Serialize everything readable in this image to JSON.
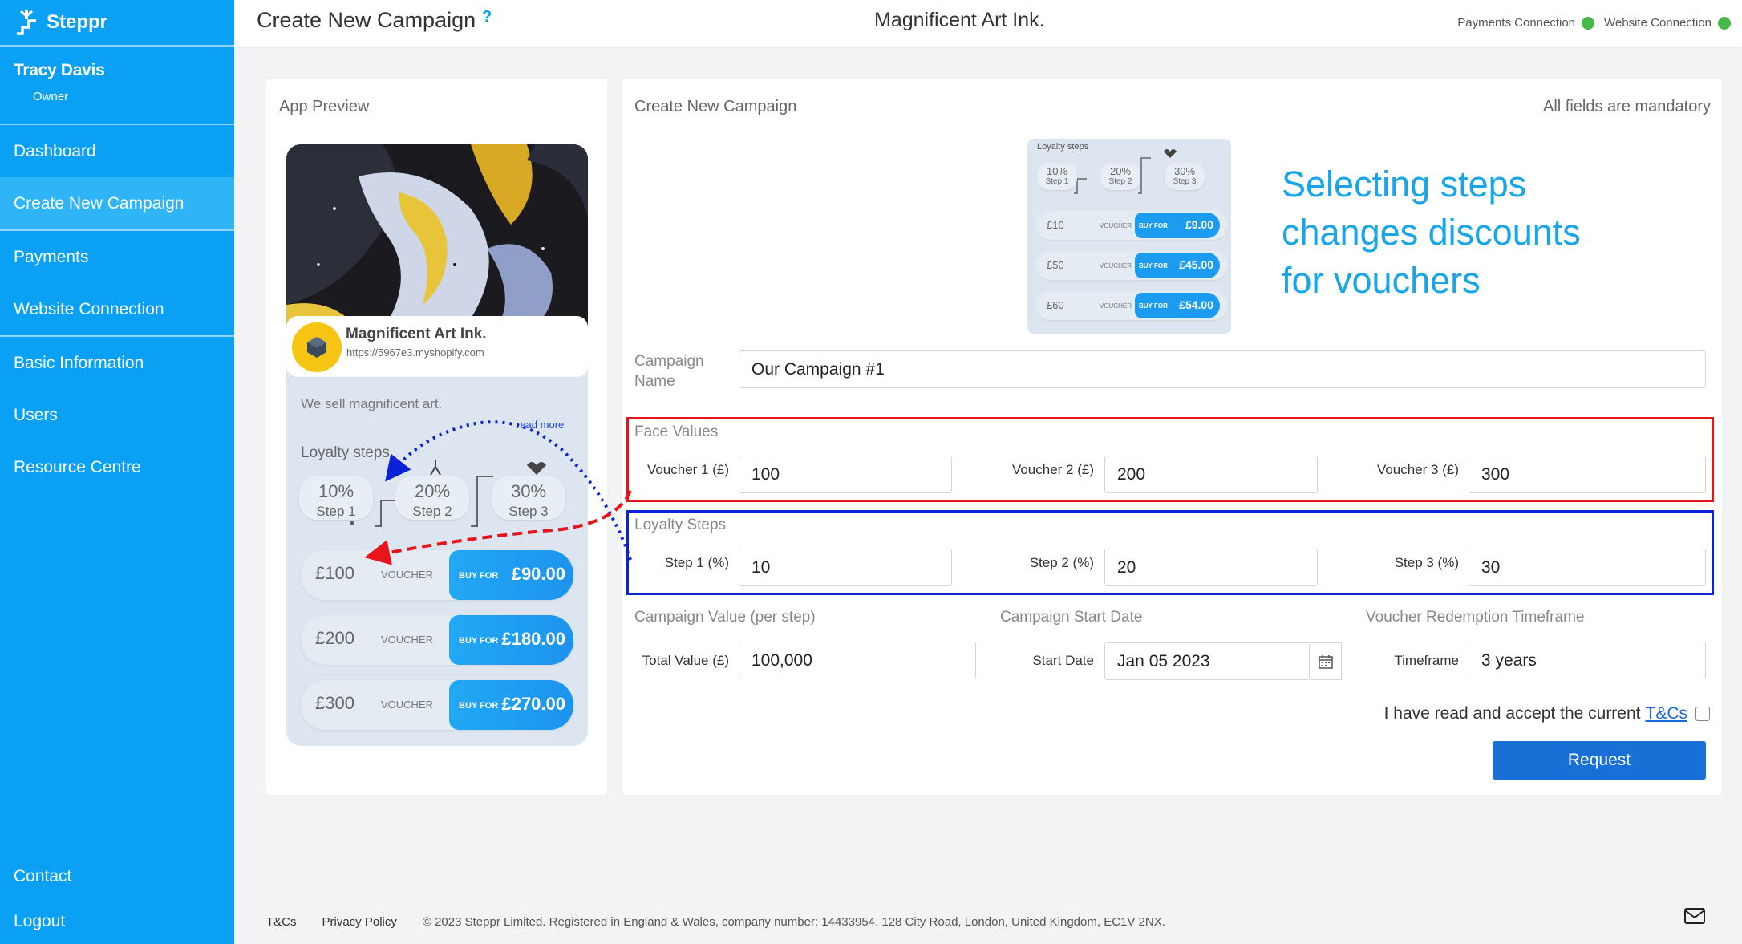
{
  "brand": {
    "name": "Steppr"
  },
  "user": {
    "name": "Tracy Davis",
    "role": "Owner"
  },
  "nav": {
    "group1": [
      "Dashboard",
      "Create New Campaign"
    ],
    "group2": [
      "Payments",
      "Website Connection"
    ],
    "group3": [
      "Basic Information",
      "Users",
      "Resource Centre"
    ],
    "bottom": [
      "Contact",
      "Logout"
    ],
    "active": "Create New Campaign"
  },
  "header": {
    "title": "Create New Campaign",
    "help": "?",
    "company": "Magnificent Art Ink.",
    "connections": [
      "Payments Connection",
      "Website Connection"
    ]
  },
  "preview": {
    "label": "App Preview",
    "shop_name": "Magnificent Art Ink.",
    "shop_url": "https://5967e3.myshopify.com",
    "description": "We sell magnificent art.",
    "read_more": "read more",
    "loyalty_label": "Loyalty steps",
    "steps": [
      {
        "pct": "10%",
        "label": "Step 1"
      },
      {
        "pct": "20%",
        "label": "Step 2"
      },
      {
        "pct": "30%",
        "label": "Step 3"
      }
    ],
    "vouchers": [
      {
        "amount": "£100",
        "label": "VOUCHER",
        "buy": "BUY FOR",
        "price": "£90.00"
      },
      {
        "amount": "£200",
        "label": "VOUCHER",
        "buy": "BUY FOR",
        "price": "£180.00"
      },
      {
        "amount": "£300",
        "label": "VOUCHER",
        "buy": "BUY FOR",
        "price": "£270.00"
      }
    ]
  },
  "form": {
    "title": "Create New Campaign",
    "mandatory": "All fields are mandatory",
    "mini": {
      "title": "Loyalty steps",
      "steps": [
        {
          "pct": "10%",
          "label": "Step 1"
        },
        {
          "pct": "20%",
          "label": "Step 2"
        },
        {
          "pct": "30%",
          "label": "Step 3"
        }
      ],
      "vouchers": [
        {
          "amount": "£10",
          "label": "VOUCHER",
          "buy": "BUY FOR",
          "price": "£9.00"
        },
        {
          "amount": "£50",
          "label": "VOUCHER",
          "buy": "BUY FOR",
          "price": "£45.00"
        },
        {
          "amount": "£60",
          "label": "VOUCHER",
          "buy": "BUY FOR",
          "price": "£54.00"
        }
      ]
    },
    "promo_lines": [
      "Selecting steps",
      "changes discounts",
      "for vouchers"
    ],
    "campaign_name_label": "Campaign Name",
    "campaign_name": "Our Campaign #1",
    "face_values": {
      "label": "Face Values",
      "fields": [
        {
          "label": "Voucher 1 (£)",
          "value": "100"
        },
        {
          "label": "Voucher 2 (£)",
          "value": "200"
        },
        {
          "label": "Voucher 3 (£)",
          "value": "300"
        }
      ],
      "border_color": "#e8141c"
    },
    "loyalty_steps": {
      "label": "Loyalty Steps",
      "fields": [
        {
          "label": "Step 1 (%)",
          "value": "10"
        },
        {
          "label": "Step 2 (%)",
          "value": "20"
        },
        {
          "label": "Step 3 (%)",
          "value": "30"
        }
      ],
      "border_color": "#0b22d8"
    },
    "campaign_value": {
      "label": "Campaign Value (per step)",
      "field_label": "Total Value (£)",
      "value": "100,000"
    },
    "start_date": {
      "label": "Campaign Start Date",
      "field_label": "Start Date",
      "value": "Jan 05 2023"
    },
    "timeframe": {
      "label": "Voucher Redemption Timeframe",
      "field_label": "Timeframe",
      "value": "3 years"
    },
    "terms_text": "I have read and accept the current",
    "terms_link": "T&Cs",
    "submit": "Request"
  },
  "footer": {
    "links": [
      "T&Cs",
      "Privacy Policy"
    ],
    "copyright": "© 2023 Steppr Limited. Registered in England & Wales, company number: 14433954. 128 City Road, London, United Kingdom, EC1V 2NX."
  },
  "colors": {
    "sidebar": "#0aa1f5",
    "accent": "#19a6e8",
    "button": "#1a6fd6",
    "status_ok": "#48b84a"
  }
}
